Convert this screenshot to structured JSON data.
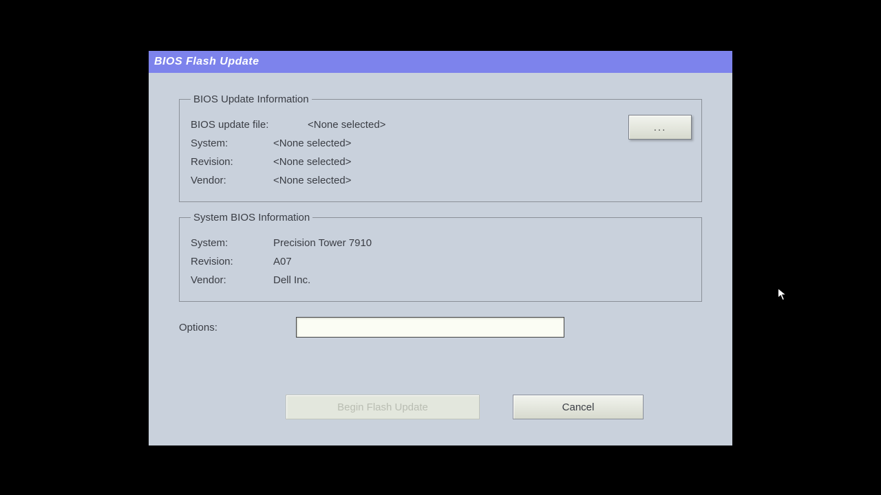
{
  "title": "BIOS Flash Update",
  "update_info": {
    "legend": "BIOS Update Information",
    "file_label": "BIOS update file:",
    "file_value": "<None selected>",
    "system_label": "System:",
    "system_value": "<None selected>",
    "revision_label": "Revision:",
    "revision_value": "<None selected>",
    "vendor_label": "Vendor:",
    "vendor_value": "<None selected>",
    "browse_label": "..."
  },
  "system_info": {
    "legend": "System BIOS Information",
    "system_label": "System:",
    "system_value": "Precision Tower 7910",
    "revision_label": "Revision:",
    "revision_value": "A07",
    "vendor_label": "Vendor:",
    "vendor_value": "Dell Inc."
  },
  "options": {
    "label": "Options:",
    "value": ""
  },
  "buttons": {
    "begin": "Begin Flash Update",
    "cancel": "Cancel"
  }
}
